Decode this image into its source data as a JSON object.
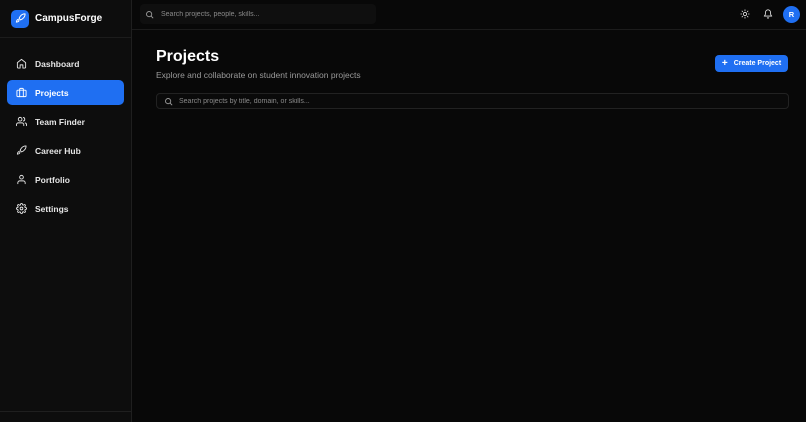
{
  "brand": {
    "name": "CampusForge"
  },
  "sidebar": {
    "items": [
      {
        "label": "Dashboard",
        "icon": "home-icon",
        "active": false
      },
      {
        "label": "Projects",
        "icon": "folder-icon",
        "active": true
      },
      {
        "label": "Team Finder",
        "icon": "users-icon",
        "active": false
      },
      {
        "label": "Career Hub",
        "icon": "rocket-icon",
        "active": false
      },
      {
        "label": "Portfolio",
        "icon": "user-icon",
        "active": false
      },
      {
        "label": "Settings",
        "icon": "gear-icon",
        "active": false
      }
    ]
  },
  "topbar": {
    "search_placeholder": "Search projects, people, skills...",
    "avatar_initial": "R"
  },
  "main": {
    "title": "Projects",
    "subtitle": "Explore and collaborate on student innovation projects",
    "create_label": "Create Project",
    "search_placeholder": "Search projects by title, domain, or skills..."
  },
  "colors": {
    "accent": "#1f6ff2",
    "background": "#080808",
    "sidebar": "#0d0d0d"
  }
}
